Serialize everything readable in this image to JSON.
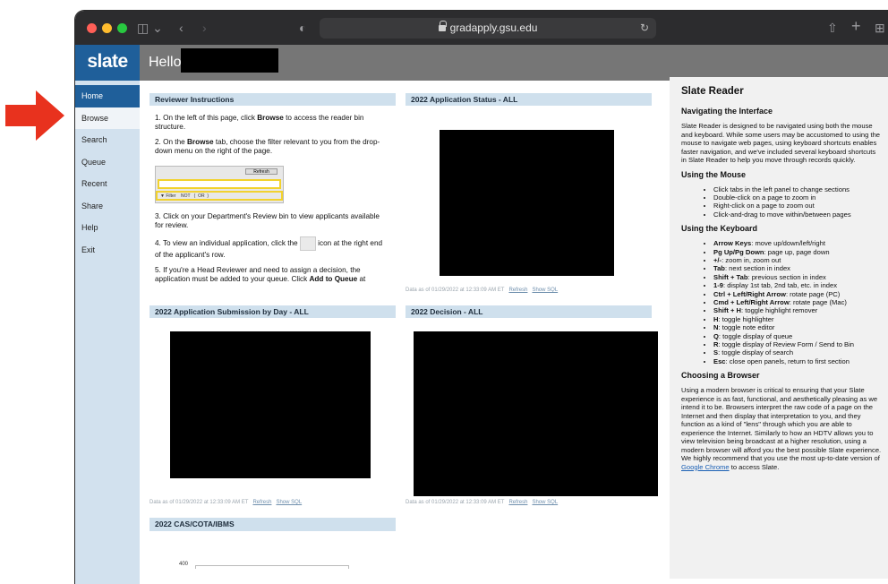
{
  "browser": {
    "url": "gradapply.gsu.edu"
  },
  "app": {
    "logo": "slate",
    "greeting": "Hello,"
  },
  "sidebar": {
    "items": [
      "Home",
      "Browse",
      "Search",
      "Queue",
      "Recent",
      "Share",
      "Help",
      "Exit"
    ]
  },
  "instructions": {
    "title": "Reviewer Instructions",
    "steps": [
      "1. On the left of this page, click Browse to access the reader bin structure.",
      "2. On the Browse tab, choose the filter relevant to you from the drop-down menu on the right of the page.",
      "3. Click on your Department's Review bin to view applicants available for review.",
      "4. To view an individual application, click the icon at the right end of the applicant's row.",
      "5. If you're a Head Reviewer and need to assign a decision, the application must be added to your queue. Click Add to Queue at"
    ],
    "filter_img": {
      "refresh": "Refresh",
      "filter": "Filter",
      "not": "NOT",
      "lp": "(",
      "or": "OR",
      "rp": ")"
    }
  },
  "panels": {
    "status": {
      "title": "2022 Application Status - ALL"
    },
    "submission": {
      "title": "2022 Application Submission by Day - ALL"
    },
    "decision": {
      "title": "2022 Decision - ALL"
    },
    "cas": {
      "title": "2022 CAS/COTA/IBMS",
      "axis_top": "400"
    },
    "footer": {
      "data_as_of": "Data as of 01/29/2022 at 12:33:09 AM ET",
      "refresh": "Refresh",
      "show_sql": "Show SQL"
    }
  },
  "reader": {
    "title": "Slate Reader",
    "nav_title": "Navigating the Interface",
    "nav_para": "Slate Reader is designed to be navigated using both the mouse and keyboard. While some users may be accustomed to using the mouse to navigate web pages, using keyboard shortcuts enables faster navigation, and we've included several keyboard shortcuts in Slate Reader to help you move through records quickly.",
    "mouse_title": "Using the Mouse",
    "mouse_items": [
      "Click tabs in the left panel to change sections",
      "Double-click on a page to zoom in",
      "Right-click on a page to zoom out",
      "Click-and-drag to move within/between pages"
    ],
    "kb_title": "Using the Keyboard",
    "kb_items": [
      {
        "k": "Arrow Keys",
        "d": ": move up/down/left/right"
      },
      {
        "k": "Pg Up/Pg Down",
        "d": ": page up, page down"
      },
      {
        "k": "+/-",
        "d": ": zoom in, zoom out"
      },
      {
        "k": "Tab",
        "d": ": next section in index"
      },
      {
        "k": "Shift + Tab",
        "d": ": previous section in index"
      },
      {
        "k": "1-9",
        "d": ": display 1st tab, 2nd tab, etc. in index"
      },
      {
        "k": "Ctrl + Left/Right Arrow",
        "d": ": rotate page (PC)"
      },
      {
        "k": "Cmd + Left/Right Arrow",
        "d": ": rotate page (Mac)"
      },
      {
        "k": "Shift + H",
        "d": ": toggle highlight remover"
      },
      {
        "k": "H",
        "d": ": toggle highlighter"
      },
      {
        "k": "N",
        "d": ": toggle note editor"
      },
      {
        "k": "Q",
        "d": ": toggle display of queue"
      },
      {
        "k": "R",
        "d": ": toggle display of Review Form / Send to Bin"
      },
      {
        "k": "S",
        "d": ": toggle display of search"
      },
      {
        "k": "Esc",
        "d": ": close open panels, return to first section"
      }
    ],
    "browser_title": "Choosing a Browser",
    "browser_para": "Using a modern browser is critical to ensuring that your Slate experience is as fast, functional, and aesthetically pleasing as we intend it to be. Browsers interpret the raw code of a page on the Internet and then display that interpretation to you, and they function as a kind of \"lens\" through which you are able to experience the Internet. Similarly to how an HDTV allows you to view television being broadcast at a higher resolution, using a modern browser will afford you the best possible Slate experience. We highly recommend that you use the most up-to-date version of",
    "browser_link": "Google Chrome",
    "browser_tail": " to access Slate."
  }
}
